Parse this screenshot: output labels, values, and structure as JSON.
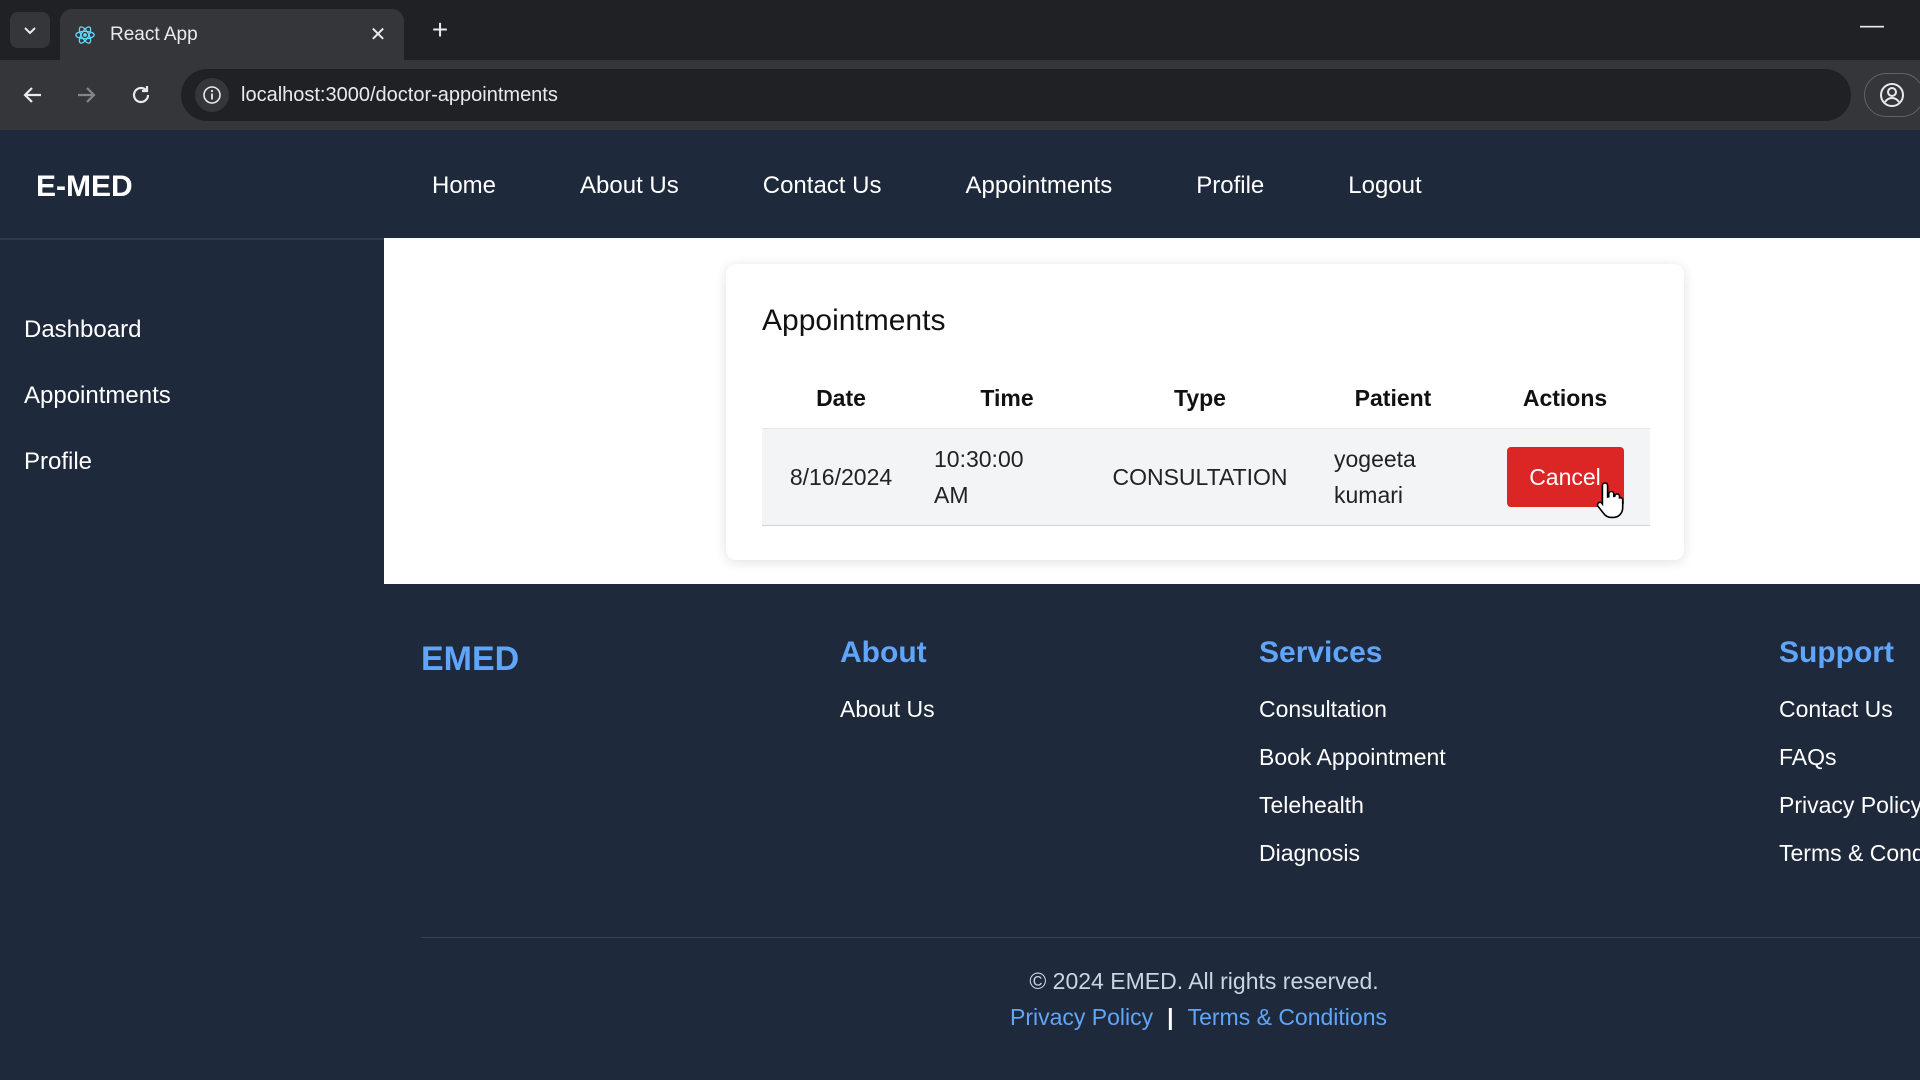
{
  "browser": {
    "tab_title": "React App",
    "url": "localhost:3000/doctor-appointments"
  },
  "header": {
    "brand": "E-MED",
    "nav": [
      "Home",
      "About Us",
      "Contact Us",
      "Appointments",
      "Profile",
      "Logout"
    ]
  },
  "sidebar": {
    "items": [
      "Dashboard",
      "Appointments",
      "Profile"
    ]
  },
  "appointments": {
    "title": "Appointments",
    "columns": [
      "Date",
      "Time",
      "Type",
      "Patient",
      "Actions"
    ],
    "rows": [
      {
        "date": "8/16/2024",
        "time_line1": "10:30:00",
        "time_line2": "AM",
        "type": "CONSULTATION",
        "patient_line1": "yogeeta",
        "patient_line2": "kumari",
        "action": "Cancel"
      }
    ],
    "cancel_color": "#dc2626"
  },
  "footer": {
    "brand": "EMED",
    "about": {
      "heading": "About",
      "links": [
        "About Us"
      ]
    },
    "services": {
      "heading": "Services",
      "links": [
        "Consultation",
        "Book Appointment",
        "Telehealth",
        "Diagnosis"
      ]
    },
    "support": {
      "heading": "Support",
      "links": [
        "Contact Us",
        "FAQs",
        "Privacy Policy",
        "Terms & Conditions"
      ]
    },
    "copyright": "© 2024 EMED. All rights reserved.",
    "privacy": "Privacy Policy",
    "separator": "|",
    "terms": "Terms & Conditions",
    "accent_color": "#60a5fa"
  }
}
